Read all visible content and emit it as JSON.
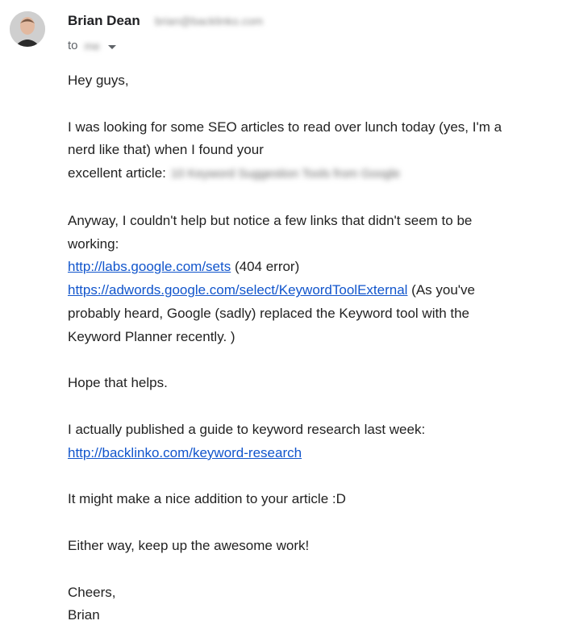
{
  "sender": {
    "name": "Brian Dean",
    "email": "brian@backlinko.com",
    "to_label": "to",
    "to_name": "me"
  },
  "message": {
    "greeting": "Hey guys,",
    "p1_line1": "I was looking for some SEO articles to read over lunch today (yes, I'm a",
    "p1_line2": "nerd like that) when I found your",
    "p1_line3": "excellent article:",
    "p1_article": "10 Keyword Suggestion Tools from Google",
    "p2_line1": "Anyway, I couldn't help but notice a few links that didn't seem to be",
    "p2_line2": "working:",
    "link1": "http://labs.google.com/sets",
    "link1_note": " (404 error)",
    "link2": "https://adwords.google.com/select/KeywordToolExternal",
    "link2_note": " (As you've",
    "p2_line5": "probably heard, Google (sadly) replaced the Keyword tool  with the",
    "p2_line6": "Keyword Planner recently. )",
    "p3": "Hope that helps.",
    "p4_line1": "I actually published a guide to keyword research last week:",
    "link3": "http://backlinko.com/keyword-research",
    "p5": "It might make a nice addition to your article :D",
    "p6": "Either way, keep up the awesome work!",
    "signoff": "Cheers,",
    "signature": "Brian"
  }
}
